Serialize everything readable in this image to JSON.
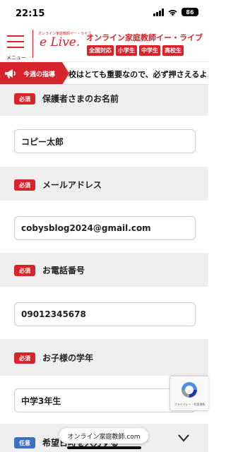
{
  "status_bar": {
    "time": "22:15",
    "battery": "86"
  },
  "header": {
    "menu_label": "メニュー",
    "logo_small": "オンライン家庭教師イー・ライブ",
    "logo_main": "e Live.",
    "title": "オンライン家庭教師イー・ライブ",
    "badges": [
      "全国対応",
      "小学生",
      "中学生",
      "高校生"
    ]
  },
  "news": {
    "tag": "今週の指導",
    "text": "校はとても重要なので、必ず押さえるよ"
  },
  "form": {
    "fields": [
      {
        "badge": "必須",
        "label": "保護者さまのお名前",
        "value": "コピー太郎"
      },
      {
        "badge": "必須",
        "label": "メールアドレス",
        "value": "cobysblog2024@gmail.com"
      },
      {
        "badge": "必須",
        "label": "お電話番号",
        "value": "09012345678"
      },
      {
        "badge": "必須",
        "label": "お子様の学年",
        "value": "中学3年生"
      },
      {
        "badge": "任意",
        "label": "希望日時を入力する"
      }
    ]
  },
  "recaptcha": {
    "text": "プライバシー・利用規約"
  },
  "bottom": {
    "url": "オンライン家庭教師.com"
  },
  "colors": {
    "brand_red": "#d7232a",
    "optional_blue": "#3a6fc4"
  }
}
